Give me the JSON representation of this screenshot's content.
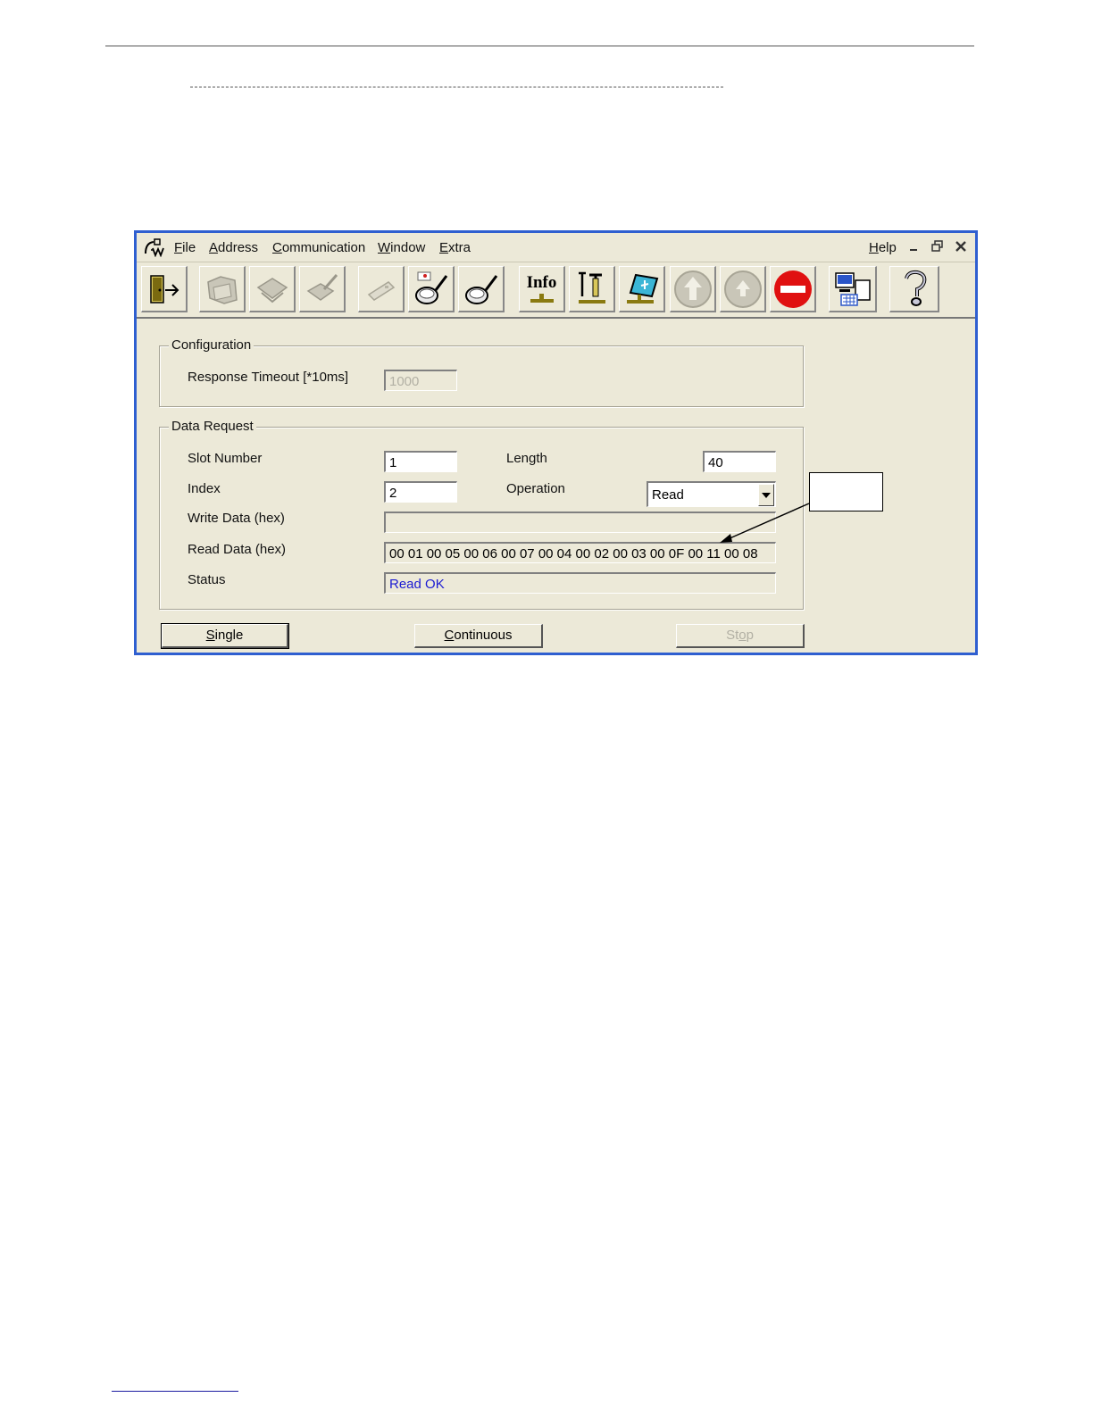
{
  "menubar": {
    "items": [
      {
        "label": "File",
        "key": "F"
      },
      {
        "label": "Address",
        "key": "A"
      },
      {
        "label": "Communication",
        "key": "C"
      },
      {
        "label": "Window",
        "key": "W"
      },
      {
        "label": "Extra",
        "key": "E"
      }
    ],
    "help": "Help",
    "controls": [
      "minimize",
      "restore",
      "close"
    ]
  },
  "toolbar": {
    "buttons": [
      {
        "icon": "exit-door-icon",
        "enabled": true
      },
      {
        "icon": "network-folder-icon",
        "enabled": false
      },
      {
        "icon": "network-connect-icon",
        "enabled": false
      },
      {
        "icon": "network-edit-icon",
        "enabled": false
      },
      {
        "icon": "envelope-icon",
        "enabled": false
      },
      {
        "icon": "magnifier-card-icon",
        "enabled": true
      },
      {
        "icon": "magnifier-icon",
        "enabled": true
      },
      {
        "icon": "info-icon",
        "label": "Info",
        "enabled": true
      },
      {
        "icon": "tools-icon",
        "enabled": true
      },
      {
        "icon": "diagnostics-screen-icon",
        "enabled": true
      },
      {
        "icon": "upload-icon",
        "enabled": false
      },
      {
        "icon": "download-icon",
        "enabled": false
      },
      {
        "icon": "stop-icon",
        "enabled": true
      },
      {
        "icon": "io-monitor-icon",
        "enabled": true
      },
      {
        "icon": "help-icon",
        "enabled": true
      }
    ],
    "info_label": "Info"
  },
  "configuration": {
    "title": "Configuration",
    "response_timeout_label": "Response Timeout [*10ms]",
    "response_timeout_value": "1000"
  },
  "data_request": {
    "title": "Data Request",
    "slot_number_label": "Slot Number",
    "slot_number_value": "1",
    "length_label": "Length",
    "length_value": "40",
    "index_label": "Index",
    "index_value": "2",
    "operation_label": "Operation",
    "operation_value": "Read",
    "write_data_label": "Write Data (hex)",
    "write_data_value": "",
    "read_data_label": "Read Data (hex)",
    "read_data_value": "00 01 00 05 00 06 00 07 00 04 00 02 00 03 00 0F 00 11 00 08",
    "status_label": "Status",
    "status_value": "Read OK"
  },
  "buttons": {
    "single": "Single",
    "continuous": "Continuous",
    "stop": "Stop"
  },
  "colors": {
    "window_border": "#2f5fd0",
    "window_bg": "#ece9d8",
    "status_text": "#1b1bd2",
    "stop_red": "#e01010"
  }
}
